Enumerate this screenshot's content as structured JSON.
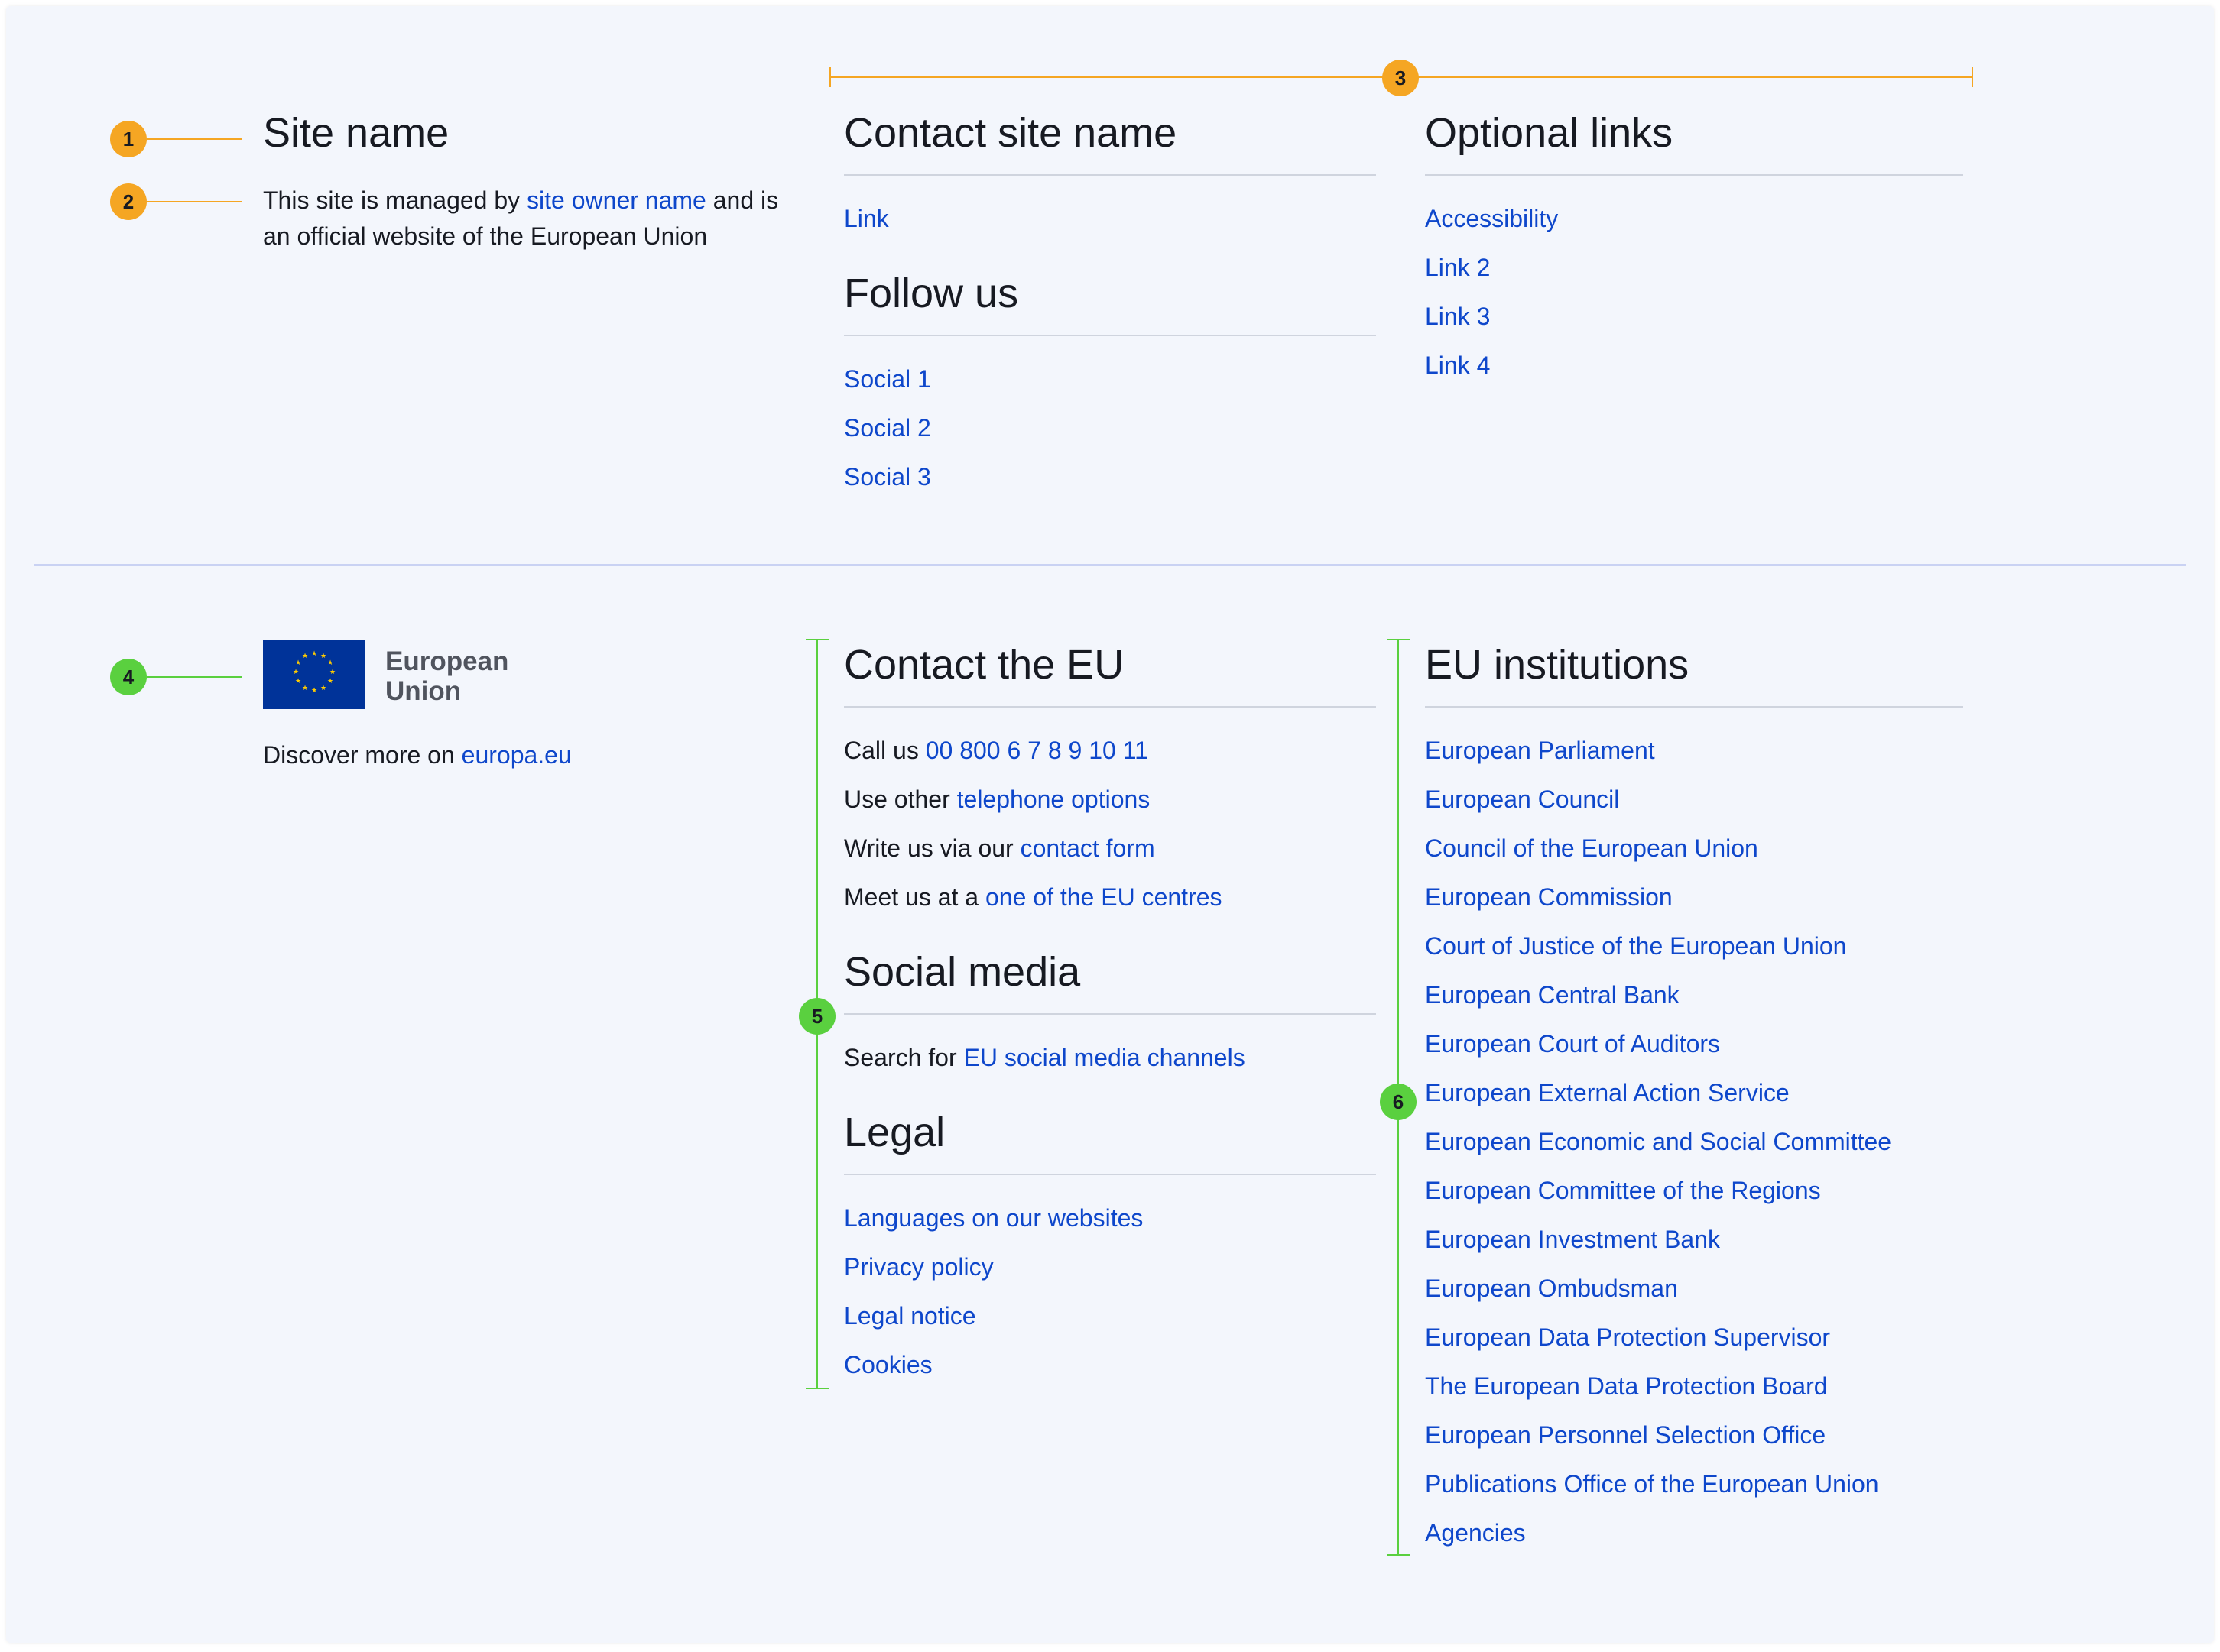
{
  "top": {
    "site_name": "Site name",
    "managed_prefix": "This site is managed by ",
    "managed_link": "site owner name",
    "managed_suffix": " and is",
    "managed_line2": "an official website of the European Union",
    "contact": {
      "title": "Contact site name",
      "links": [
        "Link"
      ]
    },
    "follow": {
      "title": "Follow us",
      "links": [
        "Social 1",
        "Social 2",
        "Social 3"
      ]
    },
    "optional": {
      "title": "Optional links",
      "links": [
        "Accessibility",
        "Link 2",
        "Link 3",
        "Link 4"
      ]
    }
  },
  "bottom": {
    "logo": {
      "line1": "European",
      "line2": "Union"
    },
    "discover_prefix": "Discover more on ",
    "discover_link": "europa.eu",
    "contact_eu": {
      "title": "Contact the EU",
      "rows": [
        {
          "prefix": "Call us ",
          "link": "00 800 6 7 8 9 10 11"
        },
        {
          "prefix": "Use other ",
          "link": "telephone options"
        },
        {
          "prefix": "Write us via our ",
          "link": "contact form"
        },
        {
          "prefix": "Meet us at a ",
          "link": "one of the EU centres"
        }
      ]
    },
    "social_media": {
      "title": "Social media",
      "prefix": "Search for ",
      "link": "EU social media channels"
    },
    "legal": {
      "title": "Legal",
      "links": [
        "Languages on our websites",
        "Privacy policy",
        "Legal notice",
        "Cookies"
      ]
    },
    "institutions": {
      "title": "EU institutions",
      "links": [
        "European Parliament",
        "European Council",
        "Council of the European Union",
        "European Commission",
        "Court of Justice of the European Union",
        "European Central Bank",
        "European Court of Auditors",
        "European External Action Service",
        "European Economic and Social Committee",
        "European Committee of the Regions",
        "European Investment Bank",
        "European Ombudsman",
        "European Data Protection Supervisor",
        "The European Data Protection Board",
        "European Personnel Selection Office",
        "Publications Office of the European Union",
        "Agencies"
      ]
    }
  },
  "annotations": [
    "1",
    "2",
    "3",
    "4",
    "5",
    "6"
  ],
  "colors": {
    "background": "#f3f6fc",
    "link": "#0e47cb",
    "text": "#171a22",
    "annotation_orange": "#f5a623",
    "annotation_green": "#5ad03f",
    "eu_flag_blue": "#003399",
    "eu_flag_stars": "#ffcc00"
  }
}
